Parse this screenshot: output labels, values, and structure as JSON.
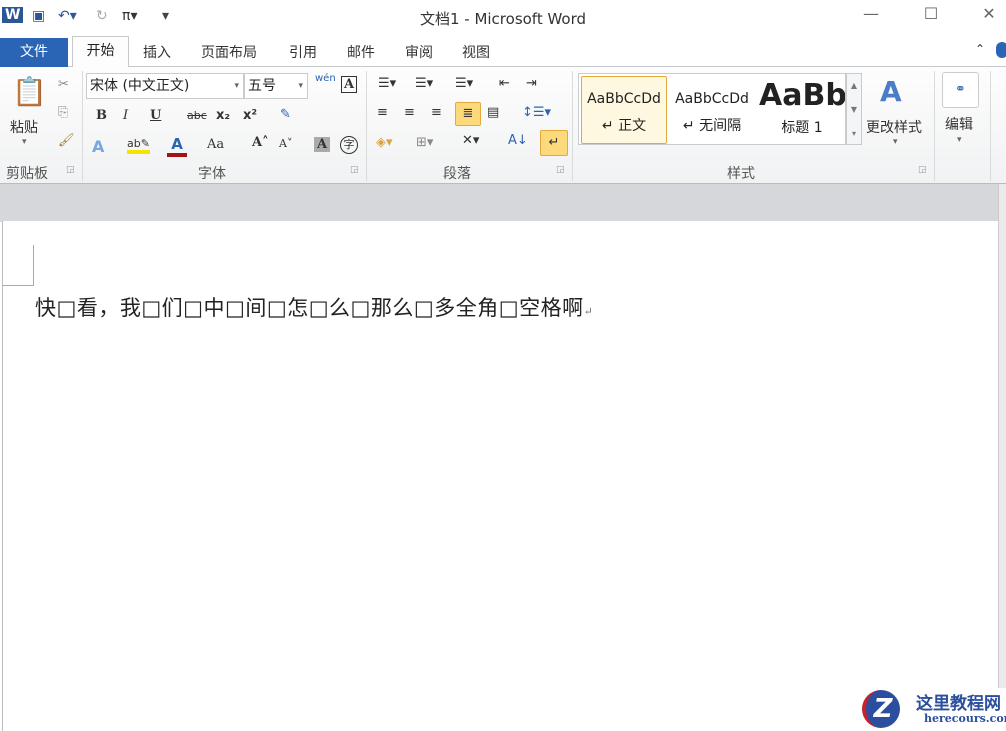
{
  "window": {
    "title": "文档1 - Microsoft Word"
  },
  "quick_access": {
    "app_icon": "W",
    "save": "save-icon",
    "undo": "undo-icon",
    "redo": "redo-icon",
    "equation": "π",
    "customize": "customize-icon"
  },
  "tabs": {
    "file": "文件",
    "home": "开始",
    "insert": "插入",
    "layout": "页面布局",
    "references": "引用",
    "mailings": "邮件",
    "review": "审阅",
    "view": "视图"
  },
  "clipboard": {
    "paste": "粘贴",
    "label": "剪贴板"
  },
  "font": {
    "name": "宋体 (中文正文)",
    "size": "五号",
    "phonetic": "wén",
    "label": "字体",
    "bold": "B",
    "italic": "I",
    "underline": "U",
    "strike": "abc",
    "sub": "x₂",
    "sup": "x²",
    "grow": "A˄",
    "shrink": "A˅",
    "case": "Aa",
    "enclose": "字",
    "charbox": "A"
  },
  "paragraph": {
    "label": "段落"
  },
  "styles": {
    "label": "样式",
    "items": [
      {
        "preview": "AaBbCcDd",
        "name": "↵ 正文"
      },
      {
        "preview": "AaBbCcDd",
        "name": "↵ 无间隔"
      },
      {
        "preview": "AaBb",
        "name": "标题 1"
      }
    ],
    "change": "更改样式"
  },
  "editing": {
    "label": "编辑"
  },
  "document": {
    "text": "快□看，我□们□中□间□怎□么□那么□多全角□空格啊",
    "mark": "↵"
  },
  "watermark": {
    "name": "这里教程网",
    "url": "herecours.com"
  }
}
